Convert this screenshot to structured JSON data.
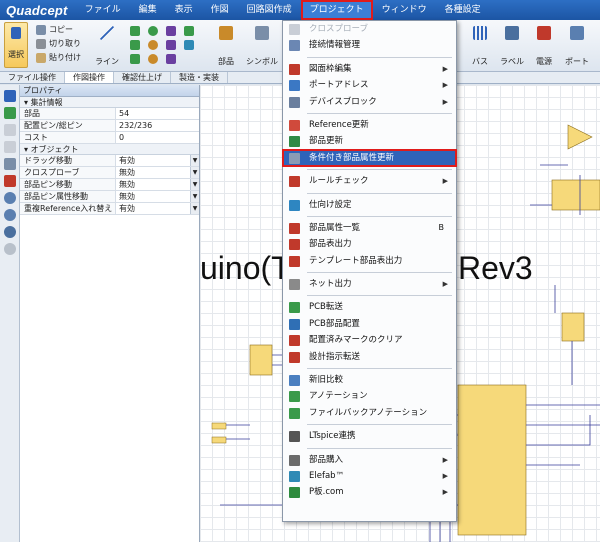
{
  "app": {
    "logo": "Quadcept"
  },
  "menubar": [
    "ファイル",
    "編集",
    "表示",
    "作図",
    "回路図作成",
    "プロジェクト",
    "ウィンドウ",
    "各種設定"
  ],
  "ribbon": {
    "select": "選択",
    "copy": "コピー",
    "cut": "切り取り",
    "paste": "貼り付け",
    "line": "ライン",
    "part": "部品",
    "symbol": "シンボル",
    "bus": "バス",
    "label": "ラベル",
    "power": "電源",
    "port": "ポート"
  },
  "tabs": [
    "ファイル操作",
    "作図操作",
    "確認仕上げ",
    "製造・実装"
  ],
  "properties": {
    "title": "プロパティ",
    "summary_header": "集計情報",
    "summary": [
      {
        "key": "部品",
        "value": "54"
      },
      {
        "key": "配置ピン/総ピン",
        "value": "232/236"
      },
      {
        "key": "コスト",
        "value": "0"
      }
    ],
    "object_header": "オブジェクト",
    "objects": [
      {
        "key": "ドラッグ移動",
        "value": "有効"
      },
      {
        "key": "クロスプローブ",
        "value": "無効"
      },
      {
        "key": "部品ピン移動",
        "value": "無効"
      },
      {
        "key": "部品ピン属性移動",
        "value": "無効"
      },
      {
        "key": "重複Reference入れ替え",
        "value": "有効"
      }
    ]
  },
  "canvas": {
    "title_left": "uino(T",
    "title_right": "Rev3"
  },
  "project_menu": {
    "items": [
      {
        "label": "クロスプローブ",
        "disabled": true,
        "icon": "crossprobe-icon",
        "color": "#c9ced6"
      },
      {
        "label": "接続情報管理",
        "icon": "connection-icon",
        "color": "#6b87b3"
      },
      {
        "sep": true
      },
      {
        "label": "図面枠編集",
        "arrow": true,
        "icon": "frame-icon",
        "color": "#c0392b"
      },
      {
        "label": "ポートアドレス",
        "arrow": true,
        "icon": "port-address-icon",
        "color": "#3b78c4"
      },
      {
        "label": "デバイスブロック",
        "arrow": true,
        "icon": "device-block-icon",
        "color": "#6a7f9e"
      },
      {
        "sep": true
      },
      {
        "label": "Reference更新",
        "icon": "reference-icon",
        "color": "#d04a3c"
      },
      {
        "label": "部品更新",
        "icon": "part-update-icon",
        "color": "#2f8a45"
      },
      {
        "label": "条件付き部品属性更新",
        "highlight": true,
        "icon": "conditional-update-icon",
        "color": "#8a9bb5"
      },
      {
        "sep": true
      },
      {
        "label": "ルールチェック",
        "arrow": true,
        "icon": "rule-check-icon",
        "color": "#c0392b"
      },
      {
        "sep": true
      },
      {
        "label": "仕向け設定",
        "icon": "destination-icon",
        "color": "#2e86c1"
      },
      {
        "sep": true
      },
      {
        "label": "部品属性一覧",
        "shortcut": "B",
        "icon": "part-list-icon",
        "color": "#c0392b"
      },
      {
        "label": "部品表出力",
        "icon": "bom-icon",
        "color": "#c0392b"
      },
      {
        "label": "テンプレート部品表出力",
        "icon": "template-bom-icon",
        "color": "#c0392b"
      },
      {
        "sep": true
      },
      {
        "label": "ネット出力",
        "arrow": true,
        "icon": "net-output-icon",
        "color": "#8a8a8a"
      },
      {
        "sep": true
      },
      {
        "label": "PCB転送",
        "icon": "pcb-transfer-icon",
        "color": "#3a9a4a"
      },
      {
        "label": "PCB部品配置",
        "icon": "pcb-place-icon",
        "color": "#2f6fb5"
      },
      {
        "label": "配置済みマークのクリア",
        "icon": "clear-mark-icon",
        "color": "#c0392b"
      },
      {
        "label": "設計指示転送",
        "icon": "design-instruction-icon",
        "color": "#c0392b"
      },
      {
        "sep": true
      },
      {
        "label": "新旧比較",
        "icon": "compare-icon",
        "color": "#4a7fc0"
      },
      {
        "label": "アノテーション",
        "icon": "annotation-icon",
        "color": "#3a9a4a"
      },
      {
        "label": "ファイルバックアノテーション",
        "icon": "back-annotation-icon",
        "color": "#3a9a4a"
      },
      {
        "sep": true
      },
      {
        "label": "LTspice連携",
        "icon": "ltspice-icon",
        "color": "#555555"
      },
      {
        "sep": true
      },
      {
        "label": "部品購入",
        "arrow": true,
        "icon": "purchase-icon",
        "color": "#6b6b6b"
      },
      {
        "label": "Elefab™",
        "arrow": true,
        "icon": "elefab-icon",
        "color": "#2f8ab5"
      },
      {
        "label": "P板.com",
        "arrow": true,
        "icon": "pban-icon",
        "color": "#2e8b3e"
      }
    ]
  }
}
